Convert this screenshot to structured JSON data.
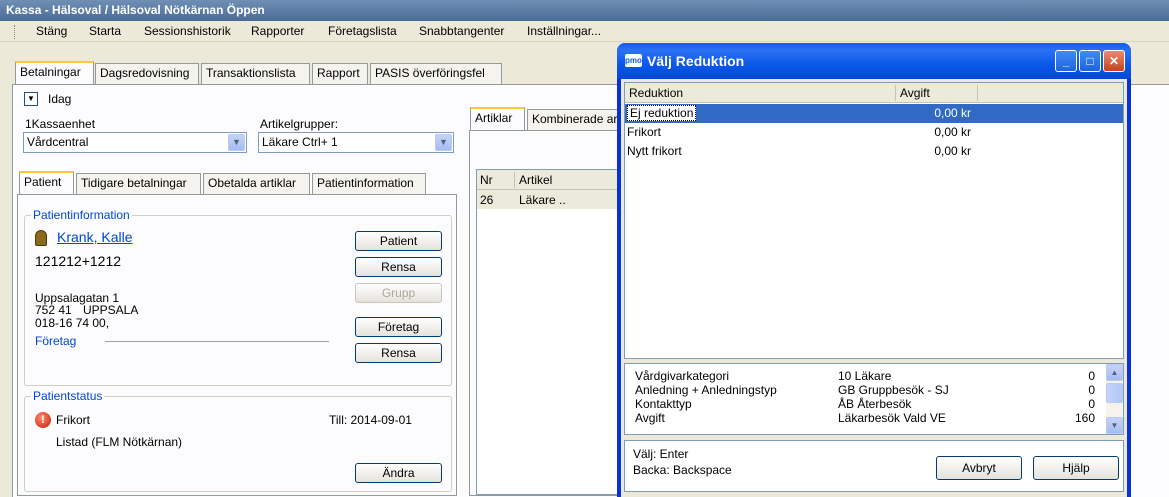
{
  "window": {
    "title": "Kassa - Hälsoval / Hälsoval Nötkärnan Öppen"
  },
  "menu": [
    "Stäng",
    "Starta",
    "Sessionshistorik",
    "Rapporter",
    "Företagslista",
    "Snabbtangenter",
    "Inställningar..."
  ],
  "main_tabs": [
    "Betalningar",
    "Dagsredovisning",
    "Transaktionslista",
    "Rapport",
    "PASIS överföringsfel"
  ],
  "date_filter": "Idag",
  "kassaenhet": {
    "label": "1Kassaenhet",
    "value": "Vårdcentral"
  },
  "artikelgrupper": {
    "label": "Artikelgrupper:",
    "value": "Läkare Ctrl+ 1"
  },
  "patient_tabs": [
    "Patient",
    "Tidigare betalningar",
    "Obetalda artiklar",
    "Patientinformation"
  ],
  "patientinfo": {
    "title": "Patientinformation",
    "name": "Krank, Kalle",
    "pnr": "121212+1212",
    "address1": "Uppsalagatan 1",
    "postcode": "752 41",
    "city": "UPPSALA",
    "phone": "018-16 74 00,",
    "company_label": "Företag",
    "buttons": {
      "patient": "Patient",
      "rensa1": "Rensa",
      "grupp": "Grupp",
      "foretag": "Företag",
      "rensa2": "Rensa"
    }
  },
  "patientstatus": {
    "title": "Patientstatus",
    "status": "Frikort",
    "till": "Till: 2014-09-01",
    "listad": "Listad (FLM Nötkärnan)",
    "andra": "Ändra"
  },
  "article_tabs": [
    "Artiklar",
    "Kombinerade ar"
  ],
  "articles": {
    "headers": [
      "Nr",
      "Artikel"
    ],
    "rows": [
      {
        "nr": "26",
        "artikel": "Läkare .."
      }
    ]
  },
  "dialog": {
    "icon": "pmo",
    "title": "Välj Reduktion",
    "headers": [
      "Reduktion",
      "Avgift"
    ],
    "rows": [
      {
        "reduktion": "Ej reduktion",
        "avgift": "0,00 kr"
      },
      {
        "reduktion": "Frikort",
        "avgift": "0,00 kr"
      },
      {
        "reduktion": "Nytt frikort",
        "avgift": "0,00 kr"
      }
    ],
    "info": [
      {
        "k": "Vårdgivarkategori",
        "v": "10 Läkare",
        "n": "0"
      },
      {
        "k": "Anledning + Anledningstyp",
        "v": "GB Gruppbesök - SJ",
        "n": "0"
      },
      {
        "k": "Kontakttyp",
        "v": "ÅB Återbesök",
        "n": "0"
      },
      {
        "k": "Avgift",
        "v": "Läkarbesök Vald VE",
        "n": "160"
      }
    ],
    "hints": [
      "Välj: Enter",
      "Backa: Backspace"
    ],
    "buttons": {
      "avbryt": "Avbryt",
      "hjalp": "Hjälp"
    }
  }
}
